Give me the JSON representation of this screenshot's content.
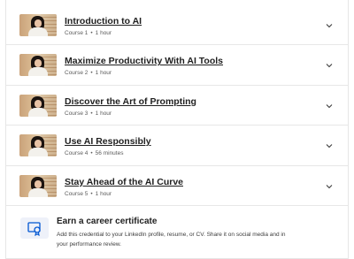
{
  "courses": [
    {
      "title": "Introduction to AI",
      "course": "Course 1",
      "duration": "1 hour"
    },
    {
      "title": "Maximize Productivity With AI Tools",
      "course": "Course 2",
      "duration": "1 hour"
    },
    {
      "title": "Discover the Art of Prompting",
      "course": "Course 3",
      "duration": "1 hour"
    },
    {
      "title": "Use AI Responsibly",
      "course": "Course 4",
      "duration": "56 minutes"
    },
    {
      "title": "Stay Ahead of the AI Curve",
      "course": "Course 5",
      "duration": "1 hour"
    }
  ],
  "meta_separator": "•",
  "certificate": {
    "title": "Earn a career certificate",
    "description": "Add this credential to your LinkedIn profile, resume, or CV. Share it on social media and in your performance review.",
    "icon": "certificate-icon"
  },
  "icons": {
    "expand": "chevron-down-icon",
    "thumbnail": "course-thumbnail"
  },
  "colors": {
    "text": "#1f1f1f",
    "muted": "#5b5b5b",
    "divider": "#e7e7e7",
    "icon_blue": "#0056d2",
    "icon_bg": "#eef1f9"
  }
}
